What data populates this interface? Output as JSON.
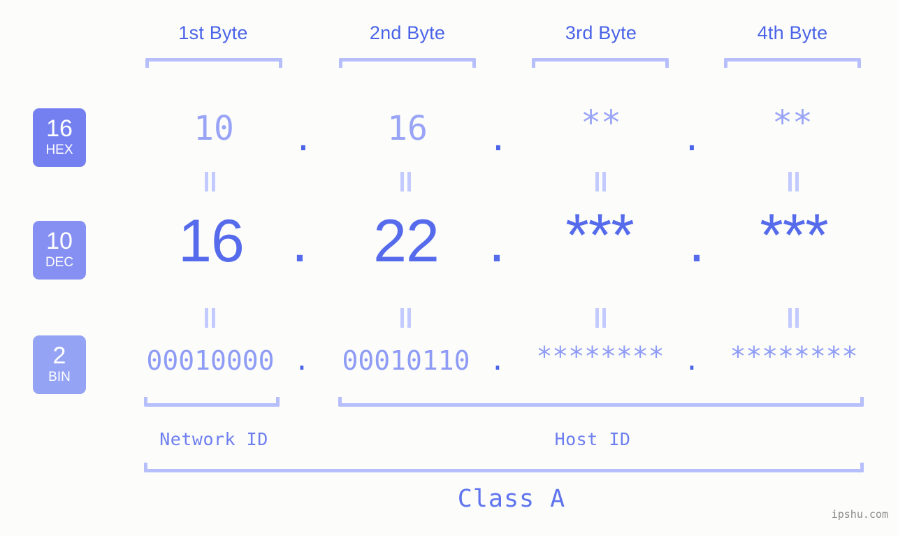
{
  "background_color": "#fcfdfa",
  "accent_color": "#4a63e8",
  "light_accent_color": "#b6bffc",
  "headers": [
    {
      "label": "1st Byte"
    },
    {
      "label": "2nd Byte"
    },
    {
      "label": "3rd Byte"
    },
    {
      "label": "4th Byte"
    }
  ],
  "bases": [
    {
      "number": "16",
      "name": "HEX",
      "color": "#7480ef"
    },
    {
      "number": "10",
      "name": "DEC",
      "color": "#8690f2"
    },
    {
      "number": "2",
      "name": "BIN",
      "color": "#95a3f5"
    }
  ],
  "rows": {
    "hex": {
      "base_number": "16",
      "base_name": "HEX",
      "values": [
        "10",
        "16",
        "**",
        "**"
      ],
      "separator": "."
    },
    "dec": {
      "base_number": "10",
      "base_name": "DEC",
      "values": [
        "16",
        "22",
        "***",
        "***"
      ],
      "separator": "."
    },
    "bin": {
      "base_number": "2",
      "base_name": "BIN",
      "values": [
        "00010000",
        "00010110",
        "********",
        "********"
      ],
      "separator": "."
    }
  },
  "equals_symbol": "||",
  "segments": {
    "network_id": "Network ID",
    "host_id": "Host ID",
    "class": "Class A"
  },
  "watermark": "ipshu.com"
}
